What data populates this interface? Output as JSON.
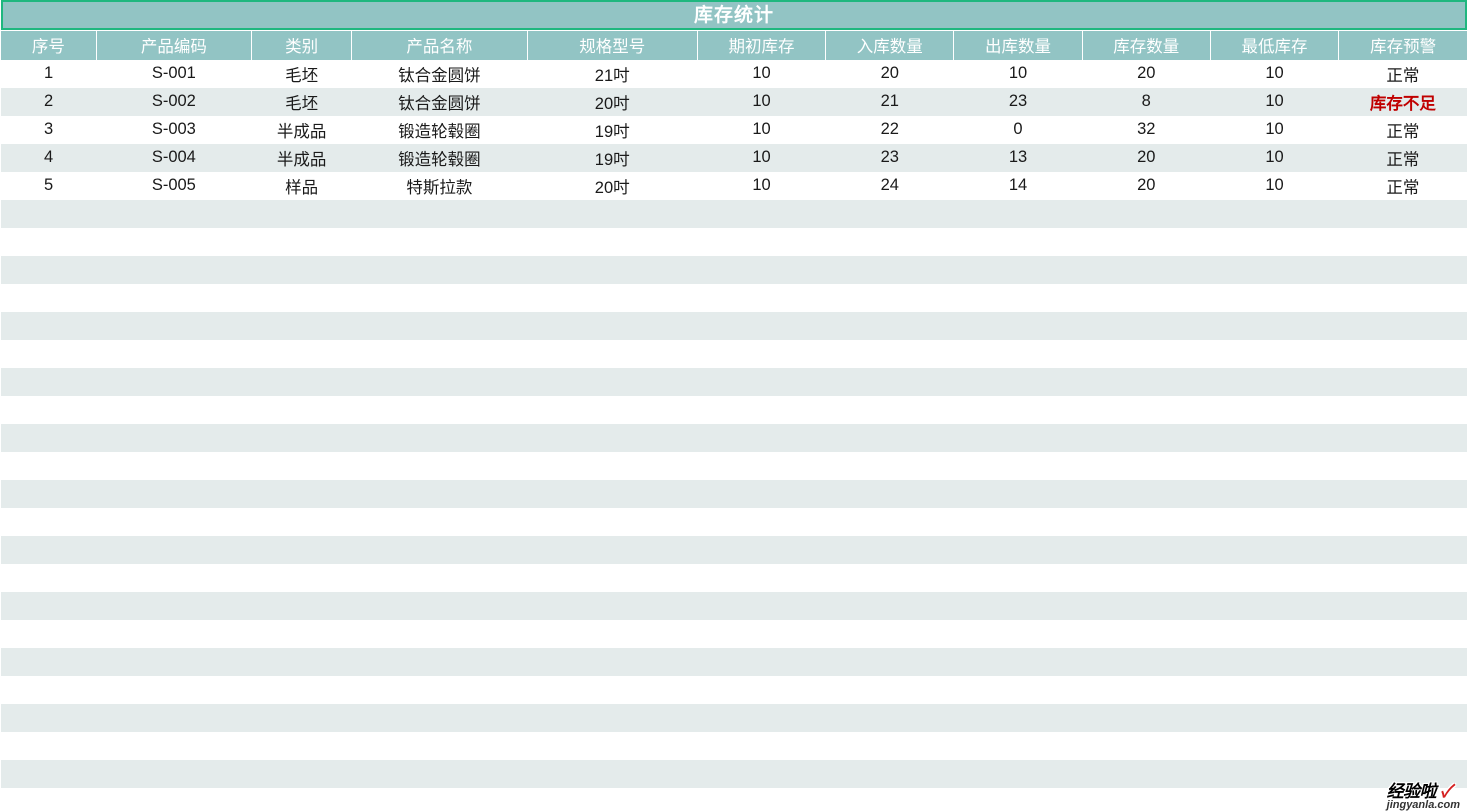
{
  "title": "库存统计",
  "headers": [
    "序号",
    "产品编码",
    "类别",
    "产品名称",
    "规格型号",
    "期初库存",
    "入库数量",
    "出库数量",
    "库存数量",
    "最低库存",
    "库存预警"
  ],
  "rows": [
    {
      "seq": "1",
      "code": "S-001",
      "cat": "毛坯",
      "name": "钛合金圆饼",
      "spec": "21吋",
      "begin": "10",
      "in": "20",
      "out": "10",
      "stock": "20",
      "min": "10",
      "alert": "正常",
      "alertFlag": false
    },
    {
      "seq": "2",
      "code": "S-002",
      "cat": "毛坯",
      "name": "钛合金圆饼",
      "spec": "20吋",
      "begin": "10",
      "in": "21",
      "out": "23",
      "stock": "8",
      "min": "10",
      "alert": "库存不足",
      "alertFlag": true
    },
    {
      "seq": "3",
      "code": "S-003",
      "cat": "半成品",
      "name": "锻造轮毂圈",
      "spec": "19吋",
      "begin": "10",
      "in": "22",
      "out": "0",
      "stock": "32",
      "min": "10",
      "alert": "正常",
      "alertFlag": false
    },
    {
      "seq": "4",
      "code": "S-004",
      "cat": "半成品",
      "name": "锻造轮毂圈",
      "spec": "19吋",
      "begin": "10",
      "in": "23",
      "out": "13",
      "stock": "20",
      "min": "10",
      "alert": "正常",
      "alertFlag": false
    },
    {
      "seq": "5",
      "code": "S-005",
      "cat": "样品",
      "name": "特斯拉款",
      "spec": "20吋",
      "begin": "10",
      "in": "24",
      "out": "14",
      "stock": "20",
      "min": "10",
      "alert": "正常",
      "alertFlag": false
    }
  ],
  "emptyRows": 21,
  "watermark": {
    "line1": "经验啦",
    "check": "✓",
    "line2": "jingyanla.com"
  }
}
